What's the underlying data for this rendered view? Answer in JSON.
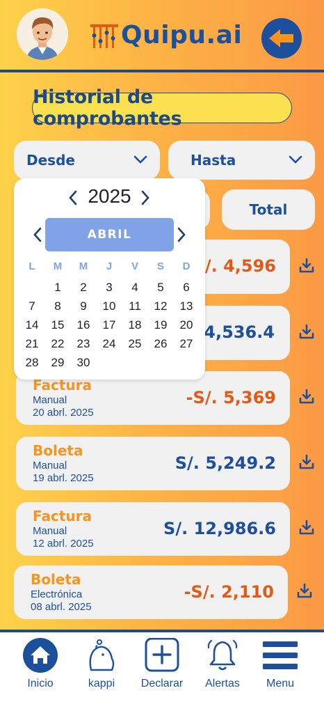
{
  "header": {
    "logo_text": "Quipu.ai"
  },
  "title": "Historial de comprobantes",
  "filters": {
    "desde_label": "Desde",
    "hasta_label": "Hasta",
    "total_label": "Total"
  },
  "calendar": {
    "year": "2025",
    "month": "ABRIL",
    "weekdays": [
      "L",
      "M",
      "M",
      "J",
      "V",
      "S",
      "D"
    ],
    "weeks": [
      [
        "",
        "1",
        "2",
        "3",
        "4",
        "5",
        "6"
      ],
      [
        "7",
        "8",
        "9",
        "10",
        "11",
        "12",
        "13"
      ],
      [
        "14",
        "15",
        "16",
        "17",
        "18",
        "19",
        "20"
      ],
      [
        "21",
        "22",
        "23",
        "24",
        "25",
        "26",
        "27"
      ],
      [
        "28",
        "29",
        "30",
        "",
        "",
        "",
        ""
      ]
    ]
  },
  "receipts": [
    {
      "amount": "S/. 4,596",
      "sign": "neg"
    },
    {
      "amount": "14,536.4",
      "sign": "pos"
    },
    {
      "type": "Factura",
      "method": "Manual",
      "date": "20 abrl. 2025",
      "amount": "-S/. 5,369",
      "sign": "neg"
    },
    {
      "type": "Boleta",
      "method": "Manual",
      "date": "19 abrl. 2025",
      "amount": "S/. 5,249.2",
      "sign": "pos"
    },
    {
      "type": "Factura",
      "method": "Manual",
      "date": "12 abrl. 2025",
      "amount": "S/. 12,986.6",
      "sign": "pos"
    },
    {
      "type": "Boleta",
      "method": "Electrónica",
      "date": "08 abrl. 2025",
      "amount": "-S/. 2,110",
      "sign": "neg"
    }
  ],
  "nav": [
    {
      "label": "Inicio",
      "icon": "home-icon"
    },
    {
      "label": "kappi",
      "icon": "capybara-icon"
    },
    {
      "label": "Declarar",
      "icon": "plus-square-icon"
    },
    {
      "label": "Alertas",
      "icon": "bell-icon"
    },
    {
      "label": "Menu",
      "icon": "menu-icon"
    }
  ],
  "colors": {
    "brand_blue": "#1c4f9c",
    "accent_orange": "#f7941d",
    "negative": "#e25a17",
    "month_highlight": "#7fa3e6"
  }
}
